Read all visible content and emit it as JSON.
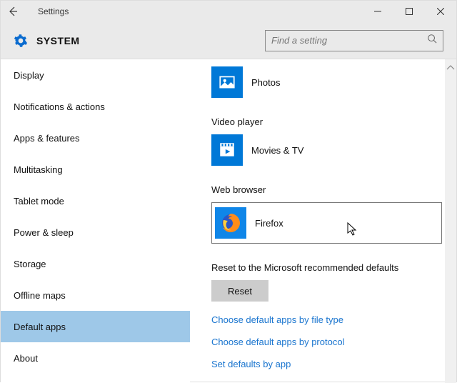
{
  "window": {
    "title": "Settings"
  },
  "header": {
    "name": "SYSTEM",
    "search_placeholder": "Find a setting"
  },
  "sidebar": {
    "items": [
      {
        "label": "Display"
      },
      {
        "label": "Notifications & actions"
      },
      {
        "label": "Apps & features"
      },
      {
        "label": "Multitasking"
      },
      {
        "label": "Tablet mode"
      },
      {
        "label": "Power & sleep"
      },
      {
        "label": "Storage"
      },
      {
        "label": "Offline maps"
      },
      {
        "label": "Default apps"
      },
      {
        "label": "About"
      }
    ],
    "selected_index": 8
  },
  "content": {
    "apps": {
      "photos": {
        "label": "Photos",
        "icon": "photos-icon"
      },
      "video_section": "Video player",
      "movies": {
        "label": "Movies & TV",
        "icon": "movies-icon"
      },
      "web_section": "Web browser",
      "web": {
        "label": "Firefox",
        "icon": "firefox-icon"
      }
    },
    "reset_label": "Reset to the Microsoft recommended defaults",
    "reset_button": "Reset",
    "links": [
      "Choose default apps by file type",
      "Choose default apps by protocol",
      "Set defaults by app"
    ]
  }
}
